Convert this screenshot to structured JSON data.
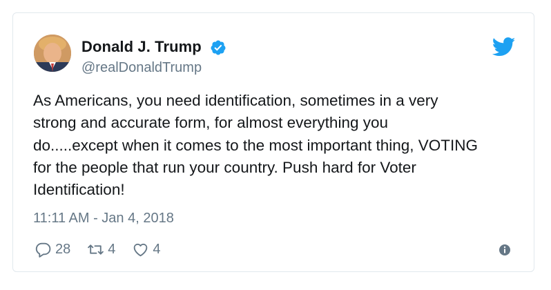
{
  "author": {
    "display_name": "Donald J. Trump",
    "handle": "@realDonaldTrump",
    "verified": true
  },
  "tweet": {
    "lines": [
      "As Americans, you need identification, sometimes in a very",
      "strong and accurate form, for almost everything you",
      "do.....except when it comes to the most important thing, VOTING",
      "for the people that run your country. Push hard for Voter",
      "Identification!"
    ],
    "timestamp": "11:11 AM - Jan 4, 2018"
  },
  "actions": {
    "replies": "28",
    "retweets": "4",
    "likes": "4"
  },
  "icons": {
    "brand": "twitter-bird-icon",
    "verified": "verified-badge-icon",
    "reply": "reply-icon",
    "retweet": "retweet-icon",
    "like": "heart-icon",
    "info": "info-icon"
  },
  "colors": {
    "brand_blue": "#1da1f2",
    "text": "#14171a",
    "secondary": "#657786",
    "border": "#e1e8ed"
  }
}
